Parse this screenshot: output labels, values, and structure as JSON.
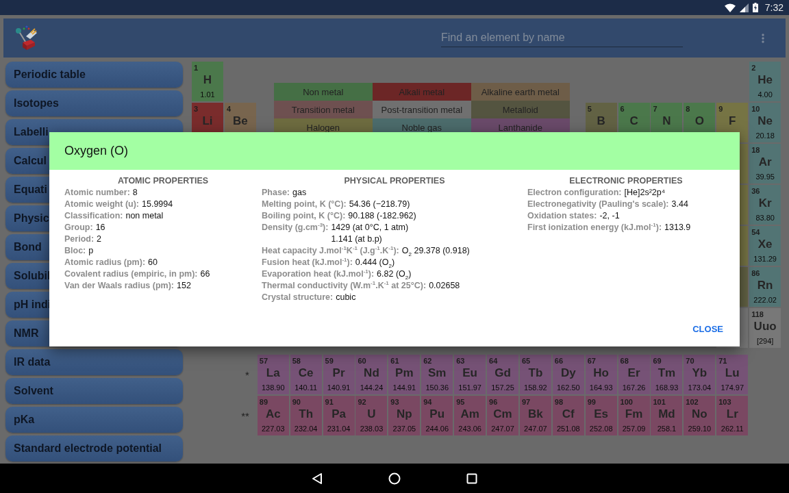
{
  "status_bar": {
    "time": "7:32"
  },
  "app_bar": {
    "search": {
      "placeholder": "Find an element by name"
    }
  },
  "sidebar": {
    "items": [
      {
        "label": "Periodic table"
      },
      {
        "label": "Isotopes"
      },
      {
        "label": "Labelli"
      },
      {
        "label": "Calcul"
      },
      {
        "label": "Equati"
      },
      {
        "label": "Physic"
      },
      {
        "label": "Bond"
      },
      {
        "label": "Solubil"
      },
      {
        "label": "pH indi"
      },
      {
        "label": "NMR"
      },
      {
        "label": "IR data"
      },
      {
        "label": "Solvent"
      },
      {
        "label": "pKa"
      },
      {
        "label": "Standard electrode potential"
      }
    ]
  },
  "legend": [
    {
      "label": "Non metal",
      "color": "#456f45"
    },
    {
      "label": "Alkali metal",
      "color": "#6c2626"
    },
    {
      "label": "Alkaline earth metal",
      "color": "#6e5d48"
    },
    {
      "label": "Transition metal",
      "color": "#6e5050"
    },
    {
      "label": "Post-transition metal",
      "color": "#707070"
    },
    {
      "label": "Metalloid",
      "color": "#545440"
    },
    {
      "label": "Halogen",
      "color": "#6e6c40"
    },
    {
      "label": "Noble gas",
      "color": "#4c6c6c"
    },
    {
      "label": "Lanthanide",
      "color": "#6a4a6a"
    }
  ],
  "table": {
    "periods": [
      {
        "left": [
          {
            "number": "1",
            "symbol": "H",
            "weight": "1.01",
            "color": "#4b784b"
          }
        ],
        "right": [
          {
            "number": "2",
            "symbol": "He",
            "weight": "4.00",
            "color": "#527474"
          }
        ]
      },
      {
        "left": [
          {
            "number": "3",
            "symbol": "Li",
            "color": "#7a2c2c"
          },
          {
            "number": "4",
            "symbol": "Be",
            "color": "#78654e"
          }
        ],
        "right": [
          {
            "number": "5",
            "symbol": "B",
            "color": "#626244"
          },
          {
            "number": "6",
            "symbol": "C",
            "color": "#4b784b"
          },
          {
            "number": "7",
            "symbol": "N",
            "color": "#4b784b"
          },
          {
            "number": "8",
            "symbol": "O",
            "color": "#4b784b"
          },
          {
            "number": "9",
            "symbol": "F",
            "color": "#767444"
          },
          {
            "number": "10",
            "symbol": "Ne",
            "weight": "20.18",
            "color": "#527474"
          }
        ]
      },
      {
        "right": [
          {
            "color": "#767444"
          },
          {
            "number": "18",
            "symbol": "Ar",
            "weight": "39.95",
            "color": "#527474"
          }
        ]
      },
      {
        "right": [
          {
            "color": "#767444"
          },
          {
            "number": "36",
            "symbol": "Kr",
            "weight": "83.80",
            "color": "#527474"
          }
        ]
      },
      {
        "right": [
          {
            "color": "#767444"
          },
          {
            "number": "54",
            "symbol": "Xe",
            "weight": "131.29",
            "color": "#527474"
          }
        ]
      },
      {
        "right": [
          {
            "color": "#626244"
          },
          {
            "number": "86",
            "symbol": "Rn",
            "weight": "222.02",
            "color": "#527474"
          }
        ]
      },
      {
        "right": [
          {
            "color": "#787878"
          },
          {
            "number": "118",
            "symbol": "Uuo",
            "weight": "[294]",
            "color": "#787878"
          }
        ]
      }
    ],
    "series": [
      {
        "mark": "*",
        "color": "#765276",
        "cells": [
          {
            "number": "57",
            "symbol": "La",
            "weight": "138.90"
          },
          {
            "number": "58",
            "symbol": "Ce",
            "weight": "140.11"
          },
          {
            "number": "59",
            "symbol": "Pr",
            "weight": "140.91"
          },
          {
            "number": "60",
            "symbol": "Nd",
            "weight": "144.24"
          },
          {
            "number": "61",
            "symbol": "Pm",
            "weight": "144.91"
          },
          {
            "number": "62",
            "symbol": "Sm",
            "weight": "150.36"
          },
          {
            "number": "63",
            "symbol": "Eu",
            "weight": "151.97"
          },
          {
            "number": "64",
            "symbol": "Gd",
            "weight": "157.25"
          },
          {
            "number": "65",
            "symbol": "Tb",
            "weight": "158.92"
          },
          {
            "number": "66",
            "symbol": "Dy",
            "weight": "162.50"
          },
          {
            "number": "67",
            "symbol": "Ho",
            "weight": "164.93"
          },
          {
            "number": "68",
            "symbol": "Er",
            "weight": "167.26"
          },
          {
            "number": "69",
            "symbol": "Tm",
            "weight": "168.93"
          },
          {
            "number": "70",
            "symbol": "Yb",
            "weight": "173.04"
          },
          {
            "number": "71",
            "symbol": "Lu",
            "weight": "174.97"
          }
        ]
      },
      {
        "mark": "**",
        "color": "#7a4862",
        "cells": [
          {
            "number": "89",
            "symbol": "Ac",
            "weight": "227.03"
          },
          {
            "number": "90",
            "symbol": "Th",
            "weight": "232.04"
          },
          {
            "number": "91",
            "symbol": "Pa",
            "weight": "231.04"
          },
          {
            "number": "92",
            "symbol": "U",
            "weight": "238.03"
          },
          {
            "number": "93",
            "symbol": "Np",
            "weight": "237.05"
          },
          {
            "number": "94",
            "symbol": "Pu",
            "weight": "244.06"
          },
          {
            "number": "95",
            "symbol": "Am",
            "weight": "243.06"
          },
          {
            "number": "96",
            "symbol": "Cm",
            "weight": "247.07"
          },
          {
            "number": "97",
            "symbol": "Bk",
            "weight": "247.07"
          },
          {
            "number": "98",
            "symbol": "Cf",
            "weight": "251.08"
          },
          {
            "number": "99",
            "symbol": "Es",
            "weight": "252.08"
          },
          {
            "number": "100",
            "symbol": "Fm",
            "weight": "257.09"
          },
          {
            "number": "101",
            "symbol": "Md",
            "weight": "258.1"
          },
          {
            "number": "102",
            "symbol": "No",
            "weight": "259.10"
          },
          {
            "number": "103",
            "symbol": "Lr",
            "weight": "262.11"
          }
        ]
      }
    ]
  },
  "dialog": {
    "title": "Oxygen (O)",
    "sections": [
      {
        "heading": "ATOMIC PROPERTIES",
        "properties": [
          {
            "label": "Atomic number:",
            "values": [
              "8"
            ]
          },
          {
            "label": "Atomic weight (u):",
            "values": [
              "15.9994"
            ]
          },
          {
            "label": "Classification:",
            "values": [
              "non metal"
            ]
          },
          {
            "label": "Group:",
            "values": [
              "16"
            ]
          },
          {
            "label": "Period:",
            "values": [
              "2"
            ]
          },
          {
            "label": "Bloc:",
            "values": [
              "p"
            ]
          },
          {
            "label": "Atomic radius (pm):",
            "values": [
              "60"
            ]
          },
          {
            "label": "Covalent radius (empiric, in pm):",
            "values": [
              "66"
            ]
          },
          {
            "label": "Van der Waals radius (pm):",
            "values": [
              "152"
            ]
          }
        ]
      },
      {
        "heading": "PHYSICAL PROPERTIES",
        "properties": [
          {
            "label": "Phase:",
            "values": [
              "gas"
            ]
          },
          {
            "label": "Melting point, K (°C):",
            "values": [
              "54.36 (−218.79)"
            ]
          },
          {
            "label": "Boiling point, K (°C):",
            "values": [
              "90.188 (-182.962)"
            ]
          },
          {
            "label": "Density (g.cm$^{-3}$):",
            "values": [
              "1429 (at 0°C, 1 atm)",
              "1.141 (at b.p)"
            ]
          },
          {
            "label": "Heat capacity J.mol$^{-1}$K$^{-1}$ (J.g$^{-1}$.K$^{-1}$):",
            "values": [
              "O$_{2}$ 29.378 (0.918)"
            ]
          },
          {
            "label": "Fusion heat (kJ.mol$^{-1}$):",
            "values": [
              "0.444 (O$_{2}$)"
            ]
          },
          {
            "label": "Evaporation heat (kJ.mol$^{-1}$):",
            "values": [
              "6.82 (O$_{2}$)"
            ]
          },
          {
            "label": "Thermal conductivity (W.m$^{-1}$.K$^{-1}$ at 25°C):",
            "values": [
              "0.02658"
            ]
          },
          {
            "label": "Crystal structure:",
            "values": [
              "cubic"
            ]
          }
        ]
      },
      {
        "heading": "ELECTRONIC PROPERTIES",
        "properties": [
          {
            "label": "Electron configuration:",
            "values": [
              "[He]2s²2p⁴"
            ]
          },
          {
            "label": "Electronegativity (Pauling's scale):",
            "values": [
              "3.44"
            ]
          },
          {
            "label": "Oxidation states:",
            "values": [
              "-2, -1"
            ]
          },
          {
            "label": "First ionization energy (kJ.mol$^{-1}$):",
            "values": [
              "1313.9"
            ]
          }
        ]
      }
    ],
    "close_button": "CLOSE"
  }
}
